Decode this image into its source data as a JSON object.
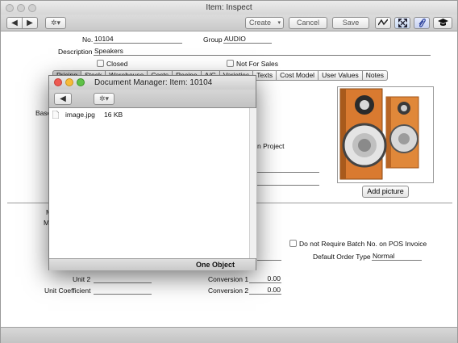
{
  "window": {
    "title": "Item: Inspect"
  },
  "toolbar": {
    "back_glyph": "◀",
    "forward_glyph": "▶",
    "gear_glyph": "✲▾",
    "create_label": "Create",
    "cancel_label": "Cancel",
    "save_label": "Save"
  },
  "form": {
    "no_label": "No.",
    "no_value": "10104",
    "group_label": "Group",
    "group_value": "AUDIO",
    "description_label": "Description",
    "description_value": "Speakers",
    "closed_label": "Closed",
    "not_for_sales_label": "Not For Sales",
    "tabs": [
      "Pricing",
      "Stock",
      "Warehouse",
      "Costs",
      "Recipe",
      "A/C",
      "Varieties",
      "Texts",
      "Cost Model",
      "User Values",
      "Notes"
    ],
    "base_label_partial": "Base",
    "project_label_partial": "n Project",
    "m_label_1": "M",
    "m_label_2": "M",
    "batch_label": "Do not Require Batch No. on POS Invoice",
    "default_order_type_label": "Default Order Type",
    "default_order_type_value": "Normal",
    "unit2_label": "Unit 2",
    "unit_coefficient_label": "Unit Coefficient",
    "conversion1_label": "Conversion 1",
    "conversion1_value": "0.00",
    "conversion2_label": "Conversion 2",
    "conversion2_value": "0.00",
    "add_picture_label": "Add picture"
  },
  "doc_manager": {
    "title": "Document Manager: Item: 10104",
    "back_glyph": "◀",
    "gear_glyph": "✲▾",
    "files": [
      {
        "name": "image.jpg",
        "size": "16 KB"
      }
    ],
    "footer": "One Object"
  }
}
